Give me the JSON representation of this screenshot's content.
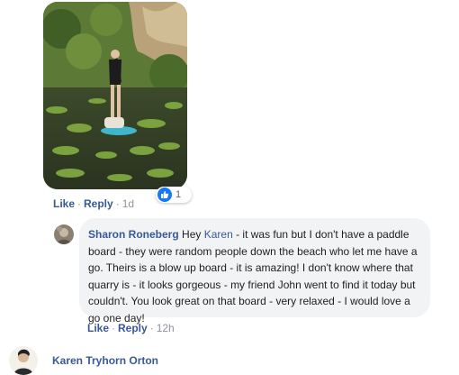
{
  "post_photo": {
    "reactions": {
      "count": "1",
      "icon": "thumbs-up-icon",
      "color": "#1877f2"
    },
    "actions": {
      "like": "Like",
      "reply": "Reply",
      "sep": "·",
      "time": "1d"
    }
  },
  "comment": {
    "author": "Sharon Roneberg",
    "text_before_mention": "Hey ",
    "mention": "Karen",
    "text_after_mention": " - it was fun but I don't have a paddle board - they were random people down the beach who let me have a go. Theirs is a blow up board - it is amazing! I don't know where that quarry is - it looks gorgeous - my friend John went to find it today but couldn't. You look great on that board - very relaxed - I would love a go one day!",
    "actions": {
      "like": "Like",
      "reply": "Reply",
      "sep": "·",
      "time": "12h"
    }
  },
  "next_comment": {
    "author": "Karen Tryhorn Orton"
  },
  "colors": {
    "link": "#385898",
    "bubble": "#f2f3f5",
    "meta": "#606770"
  }
}
